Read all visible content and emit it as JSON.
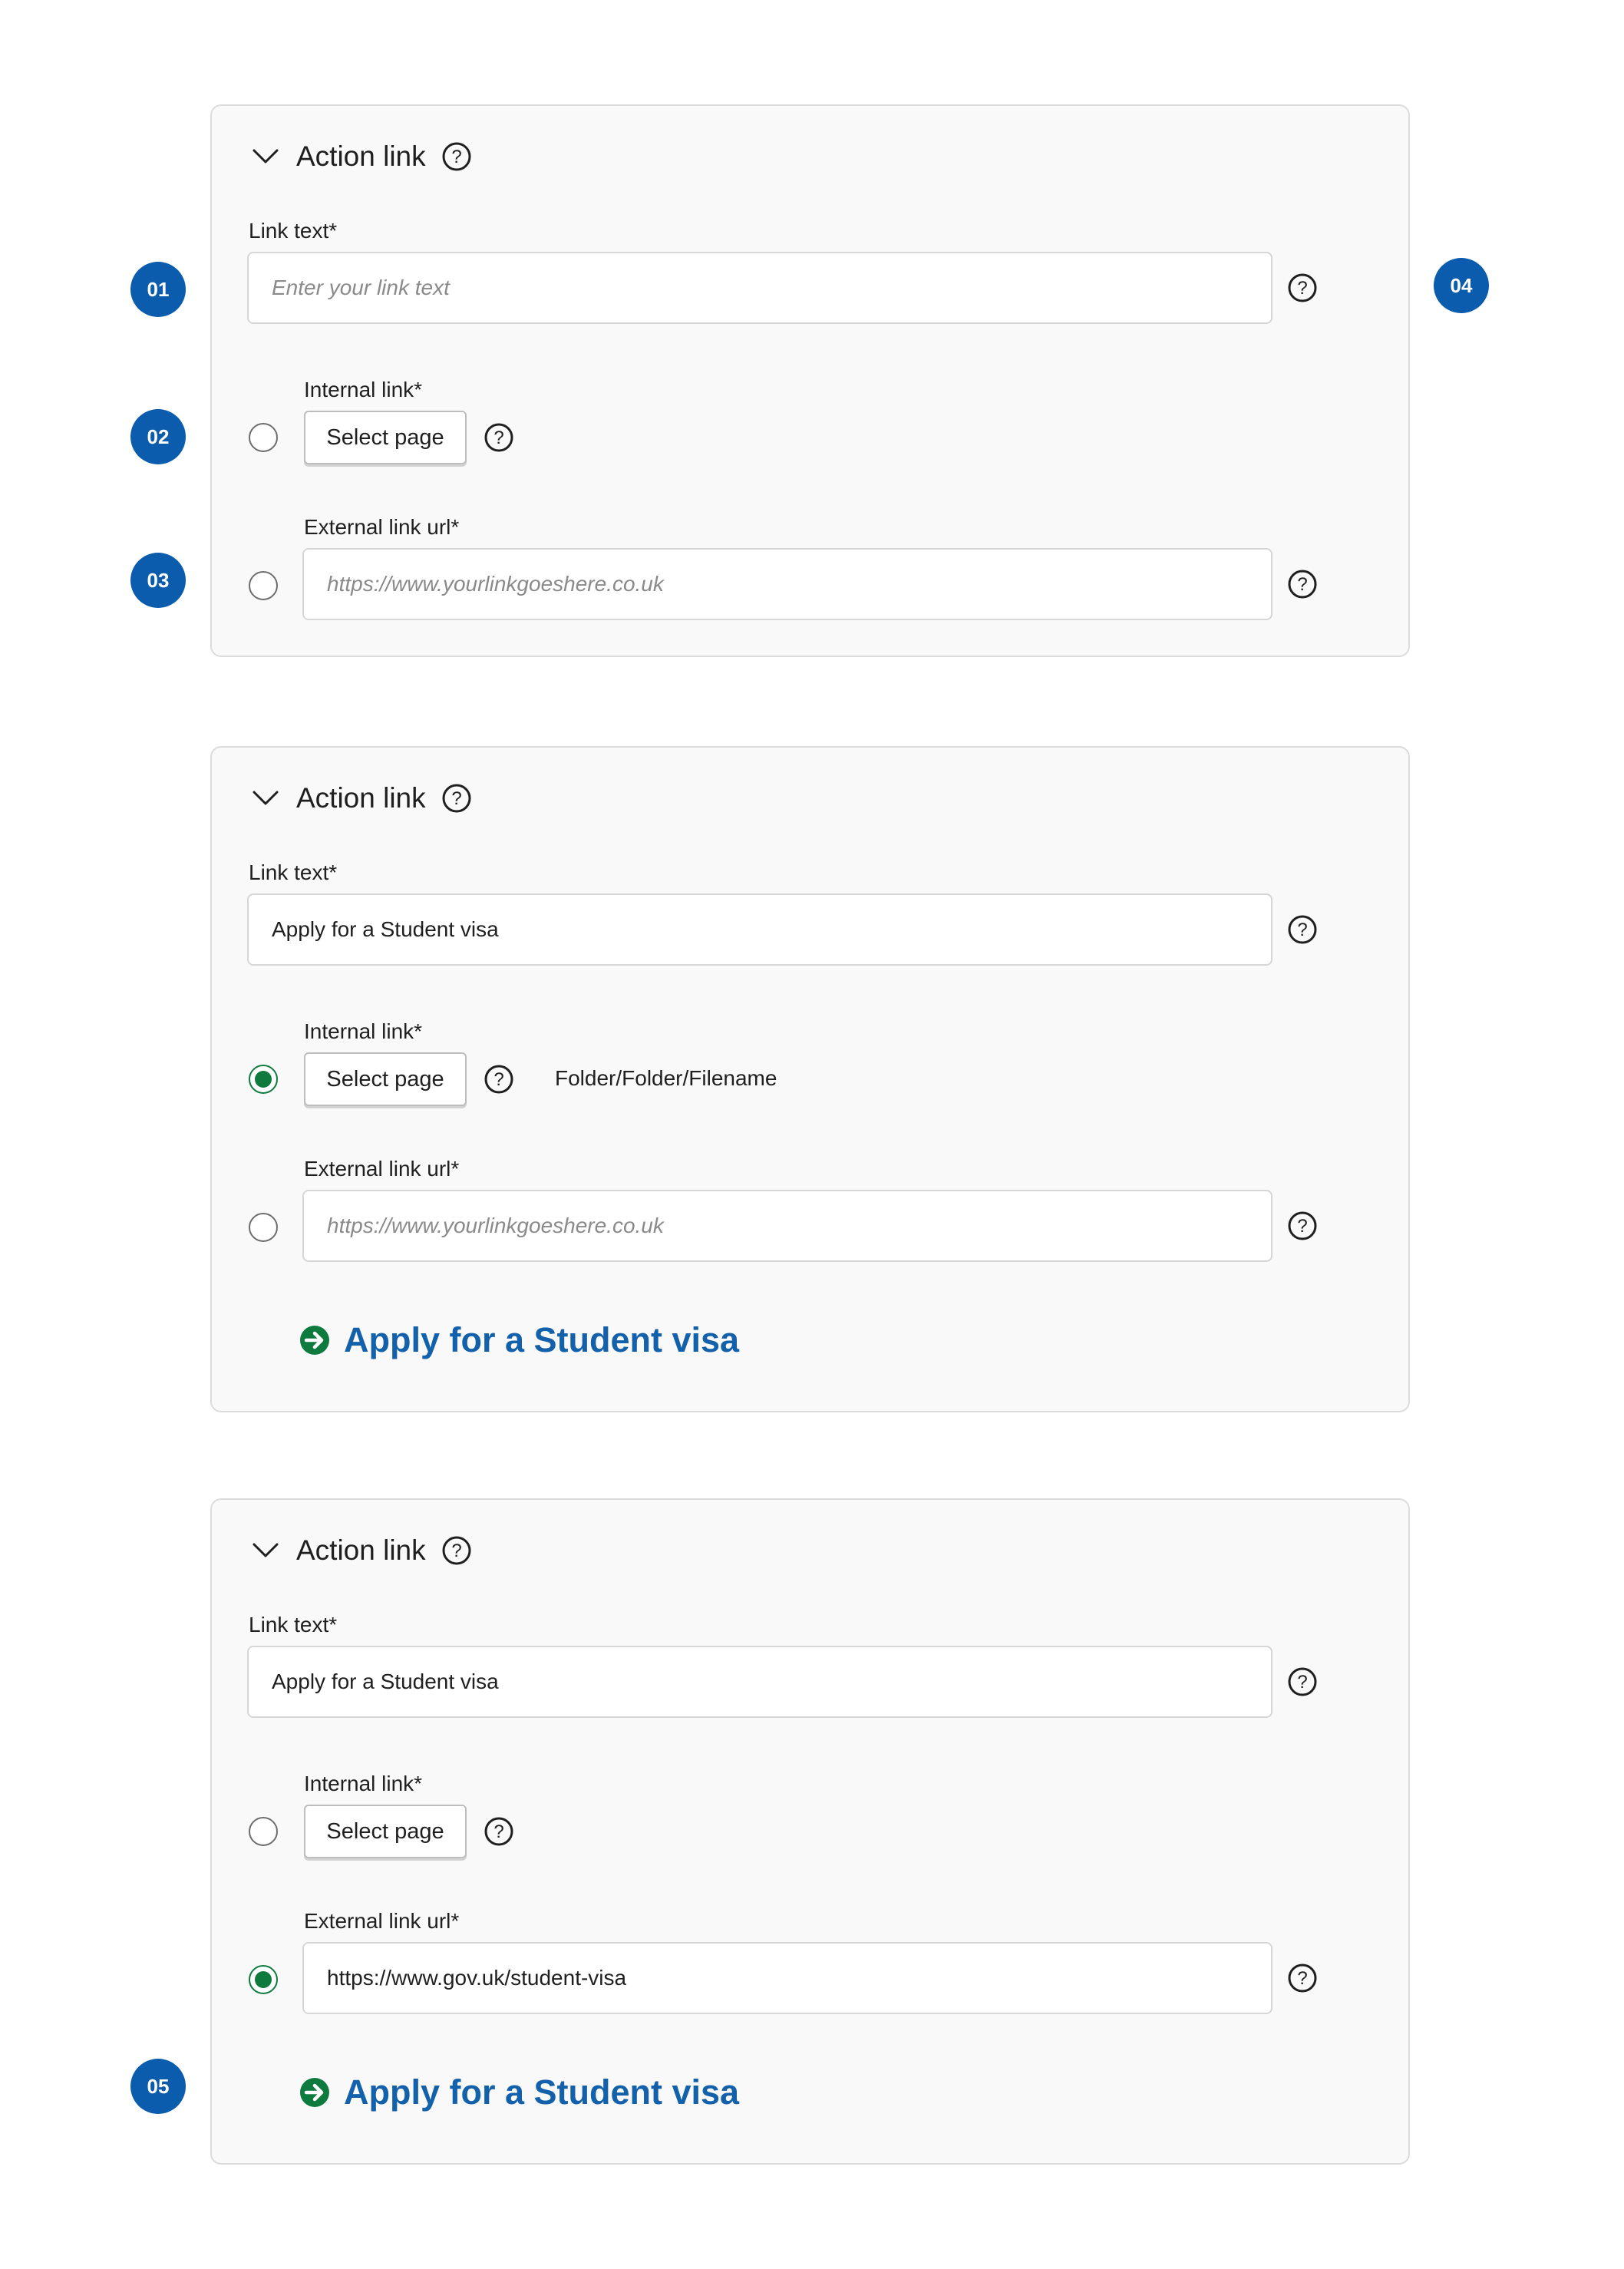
{
  "colors": {
    "badge": "#0b5cad",
    "radio_selected": "#0e7a3e",
    "action_link": "#1360ab",
    "panel_bg": "#f9f9f9",
    "panel_border": "#dcdcdc"
  },
  "icons": {
    "collapse": "chevron-down-icon",
    "help": "question-circle-icon",
    "action_arrow": "arrow-right-circle-icon"
  },
  "badges": [
    "01",
    "02",
    "03",
    "04",
    "05"
  ],
  "panels": [
    {
      "title": "Action link",
      "link_text_label": "Link text*",
      "link_text_placeholder": "Enter your link text",
      "link_text_value": "",
      "internal_label": "Internal link*",
      "select_page_label": "Select page",
      "selected_path": "",
      "external_label": "External link url*",
      "external_placeholder": "https://www.yourlinkgoeshere.co.uk",
      "external_value": "",
      "selected_option": "none",
      "preview_text": ""
    },
    {
      "title": "Action link",
      "link_text_label": "Link text*",
      "link_text_placeholder": "Enter your link text",
      "link_text_value": "Apply for a Student visa",
      "internal_label": "Internal link*",
      "select_page_label": "Select page",
      "selected_path": "Folder/Folder/Filename",
      "external_label": "External link url*",
      "external_placeholder": "https://www.yourlinkgoeshere.co.uk",
      "external_value": "",
      "selected_option": "internal",
      "preview_text": "Apply for a Student visa"
    },
    {
      "title": "Action link",
      "link_text_label": "Link text*",
      "link_text_placeholder": "Enter your link text",
      "link_text_value": "Apply for a Student visa",
      "internal_label": "Internal link*",
      "select_page_label": "Select page",
      "selected_path": "",
      "external_label": "External link url*",
      "external_placeholder": "https://www.yourlinkgoeshere.co.uk",
      "external_value": "https://www.gov.uk/student-visa",
      "selected_option": "external",
      "preview_text": "Apply for a Student visa"
    }
  ]
}
